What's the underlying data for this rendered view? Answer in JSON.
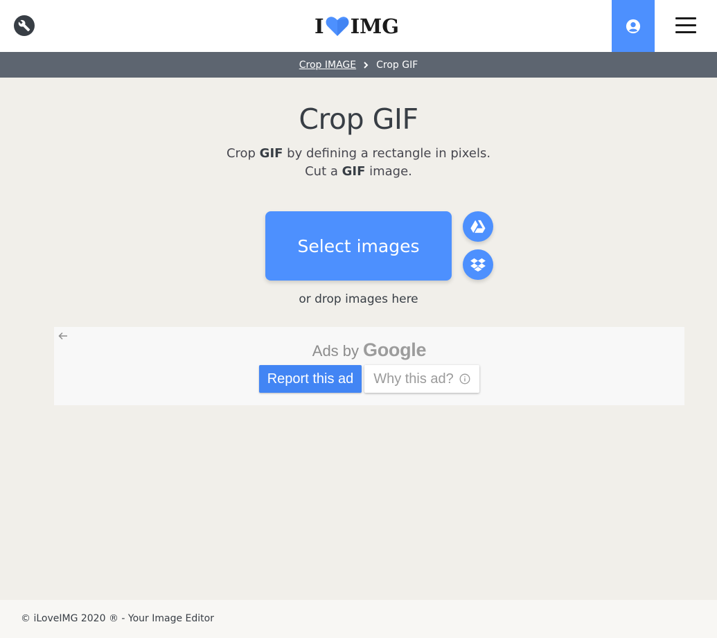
{
  "header": {
    "logo_prefix": "I",
    "logo_suffix": "IMG",
    "tools_icon": "wrench-icon",
    "user_icon": "user-circle-icon",
    "menu_icon": "hamburger-menu-icon",
    "accent": "#4d90fe"
  },
  "breadcrumb": {
    "parent": "Crop IMAGE",
    "current": "Crop GIF",
    "separator_icon": "chevron-right-icon"
  },
  "main": {
    "title": "Crop GIF",
    "subtitle_line1_pre": "Crop ",
    "subtitle_line1_bold": "GIF",
    "subtitle_line1_post": " by defining a rectangle in pixels.",
    "subtitle_line2_pre": "Cut a ",
    "subtitle_line2_bold": "GIF",
    "subtitle_line2_post": " image.",
    "select_label": "Select images",
    "drop_label": "or drop images here",
    "cloud_buttons": [
      "google-drive-icon",
      "dropbox-icon"
    ]
  },
  "ad": {
    "ads_by": "Ads by",
    "google": "Google",
    "report_label": "Report this ad",
    "why_label": "Why this ad?",
    "back_icon": "arrow-left-icon",
    "info_icon": "info-icon",
    "report_color": "#4285f4"
  },
  "footer": {
    "text": "© iLoveIMG 2020 ® - Your Image Editor"
  }
}
